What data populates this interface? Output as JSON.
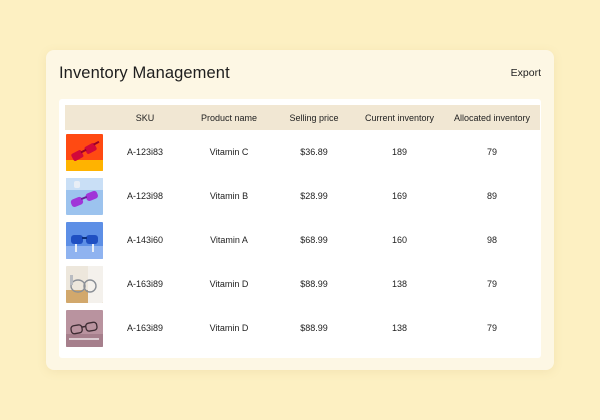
{
  "header": {
    "title": "Inventory Management",
    "export_label": "Export"
  },
  "table": {
    "columns": [
      "",
      "SKU",
      "Product name",
      "Selling price",
      "Current inventory",
      "Allocated inventory"
    ],
    "rows": [
      {
        "image": "sunglasses-red",
        "sku": "A-123i83",
        "name": "Vitamin C",
        "price": "$36.89",
        "current": "189",
        "allocated": "79"
      },
      {
        "image": "sunglasses-purple",
        "sku": "A-123i98",
        "name": "Vitamin B",
        "price": "$28.99",
        "current": "169",
        "allocated": "89"
      },
      {
        "image": "sunglasses-blue",
        "sku": "A-143i60",
        "name": "Vitamin A",
        "price": "$68.99",
        "current": "160",
        "allocated": "98"
      },
      {
        "image": "sunglasses-clear",
        "sku": "A-163i89",
        "name": "Vitamin D",
        "price": "$88.99",
        "current": "138",
        "allocated": "79"
      },
      {
        "image": "glasses-mauve",
        "sku": "A-163i89",
        "name": "Vitamin D",
        "price": "$88.99",
        "current": "138",
        "allocated": "79"
      }
    ]
  },
  "colors": {
    "page_bg": "#fdf0c2",
    "card_bg": "#fdf7e4",
    "header_row_bg": "#f1e7d3"
  }
}
